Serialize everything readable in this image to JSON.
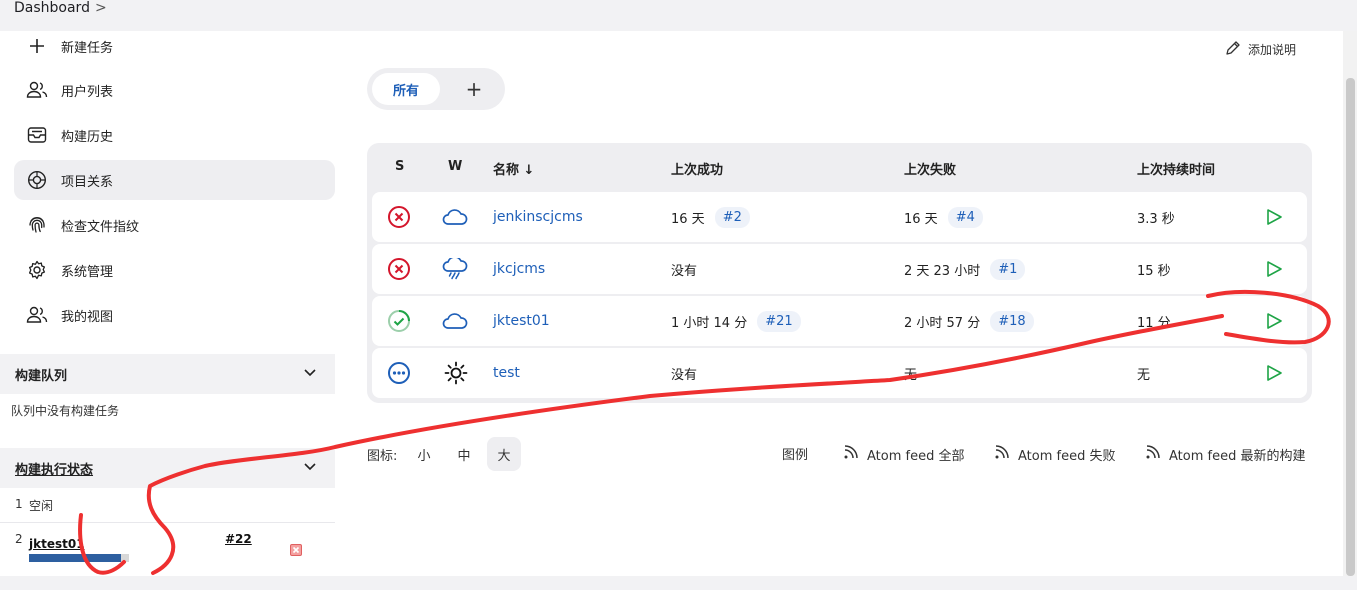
{
  "breadcrumb": {
    "root": "Dashboard",
    "separator": ">"
  },
  "sidebar": {
    "tasks": [
      {
        "label": "新建任务",
        "icon": "plus-icon"
      },
      {
        "label": "用户列表",
        "icon": "users-icon"
      },
      {
        "label": "构建历史",
        "icon": "inbox-icon"
      },
      {
        "label": "项目关系",
        "icon": "relationship-icon"
      },
      {
        "label": "检查文件指纹",
        "icon": "fingerprint-icon"
      },
      {
        "label": "系统管理",
        "icon": "gear-icon"
      },
      {
        "label": "我的视图",
        "icon": "users-icon"
      }
    ],
    "queue": {
      "title": "构建队列",
      "empty_text": "队列中没有构建任务"
    },
    "executors": {
      "title": "构建执行状态",
      "rows": [
        {
          "num": "1",
          "status": "空闲"
        },
        {
          "num": "2",
          "job": "jktest01",
          "build": "#22"
        }
      ]
    }
  },
  "main": {
    "add_description": "添加说明",
    "tabs": {
      "all": "所有",
      "add": "+"
    },
    "table": {
      "headers": {
        "s": "S",
        "w": "W",
        "name": "名称 ↓",
        "last_success": "上次成功",
        "last_failure": "上次失败",
        "last_duration": "上次持续时间"
      },
      "rows": [
        {
          "status_icon": "failed-icon",
          "weather_icon": "cloud-icon",
          "name": "jenkinscjcms",
          "success_time": "16 天",
          "success_build": "#2",
          "failure_time": "16 天",
          "failure_build": "#4",
          "duration": "3.3 秒"
        },
        {
          "status_icon": "failed-icon",
          "weather_icon": "rain-cloud-icon",
          "name": "jkcjcms",
          "success_time": "没有",
          "success_build": "",
          "failure_time": "2 天 23 小时",
          "failure_build": "#1",
          "duration": "15 秒"
        },
        {
          "status_icon": "success-icon",
          "weather_icon": "cloud-icon",
          "name": "jktest01",
          "success_time": "1 小时 14 分",
          "success_build": "#21",
          "failure_time": "2 小时 57 分",
          "failure_build": "#18",
          "duration": "11 分"
        },
        {
          "status_icon": "not-built-icon",
          "weather_icon": "sun-icon",
          "name": "test",
          "success_time": "没有",
          "success_build": "",
          "failure_time": "无",
          "failure_build": "",
          "duration": "无"
        }
      ]
    },
    "icon_size": {
      "label": "图标:",
      "small": "小",
      "medium": "中",
      "large": "大",
      "selected": "大"
    },
    "footer_links": {
      "legend": "图例",
      "feed_all": "Atom feed 全部",
      "feed_failed": "Atom feed 失败",
      "feed_latest": "Atom feed 最新的构建"
    }
  },
  "colors": {
    "link": "#1e5fb8",
    "fail": "#d4162c",
    "success": "#1ea446",
    "info": "#1e5fb8",
    "annotation": "#ee3030",
    "progress": "#2d5fa0"
  }
}
